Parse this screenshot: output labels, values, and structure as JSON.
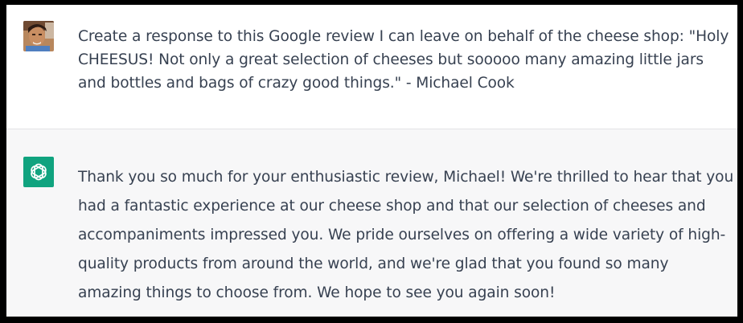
{
  "conversation": {
    "user_message": {
      "avatar_icon": "user-photo-avatar",
      "text": "Create a response to this Google review I can leave on behalf of the cheese shop: \"Holy CHEESUS! Not only a great selection of cheeses but sooooo many amazing little jars and bottles and bags of crazy good things.\" - Michael Cook"
    },
    "assistant_message": {
      "avatar_icon": "openai-logo-icon",
      "avatar_color": "#10a37f",
      "text": "Thank you so much for your enthusiastic review, Michael! We're thrilled to hear that you had a fantastic experience at our cheese shop and that our selection of cheeses and accompaniments impressed you. We pride ourselves on offering a wide variety of high-quality products from around the world, and we're glad that you found so many amazing things to choose from. We hope to see you again soon!"
    }
  },
  "colors": {
    "user_bg": "#ffffff",
    "assistant_bg": "#f7f7f8",
    "text": "#374151",
    "frame": "#000000"
  }
}
